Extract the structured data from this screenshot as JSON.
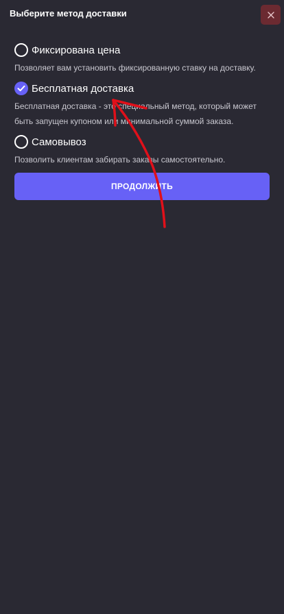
{
  "header": {
    "title": "Выберите метод доставки"
  },
  "options": [
    {
      "label": "Фиксирована цена",
      "description": "Позволяет вам установить фиксированную ставку на доставку.",
      "selected": false
    },
    {
      "label": "Бесплатная доставка",
      "description": "Бесплатная доставка - это специальный метод, который может быть запущен купоном или минимальной суммой заказа.",
      "selected": true
    },
    {
      "label": "Самовывоз",
      "description": "Позволить клиентам забирать заказы самостоятельно.",
      "selected": false
    }
  ],
  "continue_button": {
    "label": "ПРОДОЛЖИТЬ"
  },
  "colors": {
    "background": "#2a2933",
    "accent": "#6761f6",
    "close_button": "#6b2a31",
    "annotation": "#e0101a"
  },
  "icons": {
    "close": "close-icon",
    "check": "checkmark-icon"
  }
}
